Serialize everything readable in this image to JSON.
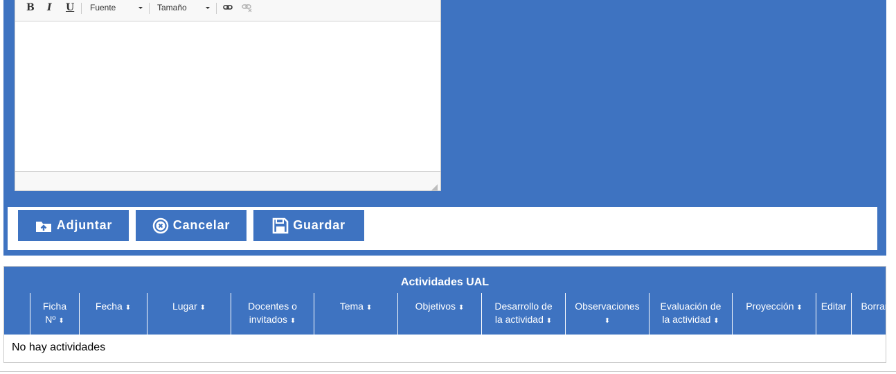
{
  "editor": {
    "toolbar": {
      "bold": "B",
      "italic": "I",
      "underline": "U",
      "font_label": "Fuente",
      "size_label": "Tamaño",
      "icons": [
        "link-icon",
        "unlink-icon"
      ]
    }
  },
  "actions": {
    "attach_label": "Adjuntar",
    "cancel_label": "Cancelar",
    "save_label": "Guardar"
  },
  "table": {
    "title": "Actividades UAL",
    "columns": [
      {
        "line1": "Ficha",
        "line2": "Nº"
      },
      {
        "line1": "Fecha",
        "line2": ""
      },
      {
        "line1": "Lugar",
        "line2": ""
      },
      {
        "line1": "Docentes o",
        "line2": "invitados"
      },
      {
        "line1": "Tema",
        "line2": ""
      },
      {
        "line1": "Objetivos",
        "line2": ""
      },
      {
        "line1": "Desarrollo de",
        "line2": "la actividad"
      },
      {
        "line1": "Observaciones",
        "line2": ""
      },
      {
        "line1": "Evaluación de",
        "line2": "la actividad"
      },
      {
        "line1": "Proyección",
        "line2": ""
      },
      {
        "line1": "Editar",
        "line2": ""
      },
      {
        "line1": "Borrar",
        "line2": ""
      }
    ],
    "empty_message": "No hay actividades"
  },
  "colors": {
    "accent": "#3e73c1",
    "text_on_accent": "#ffffff"
  }
}
